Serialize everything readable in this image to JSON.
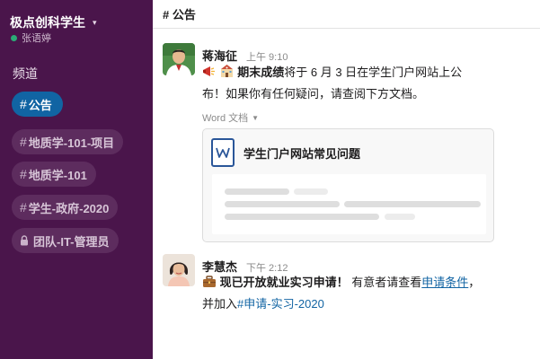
{
  "sidebar": {
    "workspace_name": "极点创科学生",
    "user_name": "张语婷",
    "section_title": "频道",
    "channels": [
      {
        "hash": "#",
        "name": "公告"
      },
      {
        "hash": "#",
        "name": "地质学-101-项目"
      },
      {
        "hash": "#",
        "name": "地质学-101"
      },
      {
        "hash": "#",
        "name": "学生-政府-2020"
      },
      {
        "hash": "",
        "name": "团队-IT-管理员"
      }
    ]
  },
  "header": {
    "channel_title": "# 公告"
  },
  "messages": [
    {
      "author": "蒋海征",
      "time": "上午 9:10",
      "bold_text": "期末成绩",
      "line1_rest": "将于 6 月 3 日在学生门户网站上公",
      "line2": "布！如果你有任何疑问，请查阅下方文档。",
      "file_type_label": "Word 文档",
      "file_title": "学生门户网站常见问题"
    },
    {
      "author": "李慧杰",
      "time": "下午 2:12",
      "bold_text": "现已开放就业实习申请！",
      "line1_mid": "有意者请查看",
      "link_text": "申请条件",
      "line1_end": "，",
      "line2_prefix": "并加入",
      "channel_link": "#申请-实习-2020"
    }
  ],
  "colors": {
    "sidebar_bg": "#4a154b",
    "active_channel": "#1164a3",
    "link": "#1264a3",
    "presence": "#2bac76"
  }
}
